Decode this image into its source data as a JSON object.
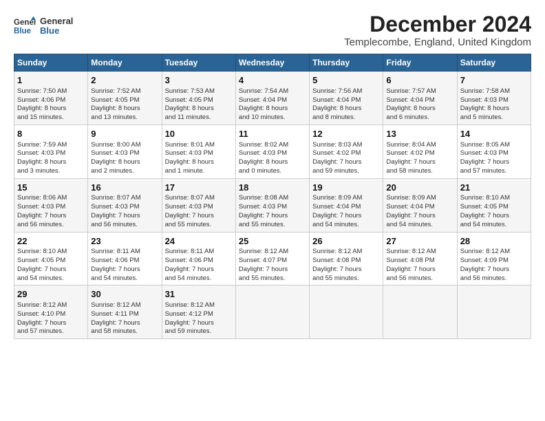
{
  "header": {
    "logo_line1": "General",
    "logo_line2": "Blue",
    "title": "December 2024",
    "subtitle": "Templecombe, England, United Kingdom"
  },
  "days_of_week": [
    "Sunday",
    "Monday",
    "Tuesday",
    "Wednesday",
    "Thursday",
    "Friday",
    "Saturday"
  ],
  "weeks": [
    [
      {
        "day": "1",
        "info": "Sunrise: 7:50 AM\nSunset: 4:06 PM\nDaylight: 8 hours\nand 15 minutes."
      },
      {
        "day": "2",
        "info": "Sunrise: 7:52 AM\nSunset: 4:05 PM\nDaylight: 8 hours\nand 13 minutes."
      },
      {
        "day": "3",
        "info": "Sunrise: 7:53 AM\nSunset: 4:05 PM\nDaylight: 8 hours\nand 11 minutes."
      },
      {
        "day": "4",
        "info": "Sunrise: 7:54 AM\nSunset: 4:04 PM\nDaylight: 8 hours\nand 10 minutes."
      },
      {
        "day": "5",
        "info": "Sunrise: 7:56 AM\nSunset: 4:04 PM\nDaylight: 8 hours\nand 8 minutes."
      },
      {
        "day": "6",
        "info": "Sunrise: 7:57 AM\nSunset: 4:04 PM\nDaylight: 8 hours\nand 6 minutes."
      },
      {
        "day": "7",
        "info": "Sunrise: 7:58 AM\nSunset: 4:03 PM\nDaylight: 8 hours\nand 5 minutes."
      }
    ],
    [
      {
        "day": "8",
        "info": "Sunrise: 7:59 AM\nSunset: 4:03 PM\nDaylight: 8 hours\nand 3 minutes."
      },
      {
        "day": "9",
        "info": "Sunrise: 8:00 AM\nSunset: 4:03 PM\nDaylight: 8 hours\nand 2 minutes."
      },
      {
        "day": "10",
        "info": "Sunrise: 8:01 AM\nSunset: 4:03 PM\nDaylight: 8 hours\nand 1 minute."
      },
      {
        "day": "11",
        "info": "Sunrise: 8:02 AM\nSunset: 4:03 PM\nDaylight: 8 hours\nand 0 minutes."
      },
      {
        "day": "12",
        "info": "Sunrise: 8:03 AM\nSunset: 4:02 PM\nDaylight: 7 hours\nand 59 minutes."
      },
      {
        "day": "13",
        "info": "Sunrise: 8:04 AM\nSunset: 4:02 PM\nDaylight: 7 hours\nand 58 minutes."
      },
      {
        "day": "14",
        "info": "Sunrise: 8:05 AM\nSunset: 4:03 PM\nDaylight: 7 hours\nand 57 minutes."
      }
    ],
    [
      {
        "day": "15",
        "info": "Sunrise: 8:06 AM\nSunset: 4:03 PM\nDaylight: 7 hours\nand 56 minutes."
      },
      {
        "day": "16",
        "info": "Sunrise: 8:07 AM\nSunset: 4:03 PM\nDaylight: 7 hours\nand 56 minutes."
      },
      {
        "day": "17",
        "info": "Sunrise: 8:07 AM\nSunset: 4:03 PM\nDaylight: 7 hours\nand 55 minutes."
      },
      {
        "day": "18",
        "info": "Sunrise: 8:08 AM\nSunset: 4:03 PM\nDaylight: 7 hours\nand 55 minutes."
      },
      {
        "day": "19",
        "info": "Sunrise: 8:09 AM\nSunset: 4:04 PM\nDaylight: 7 hours\nand 54 minutes."
      },
      {
        "day": "20",
        "info": "Sunrise: 8:09 AM\nSunset: 4:04 PM\nDaylight: 7 hours\nand 54 minutes."
      },
      {
        "day": "21",
        "info": "Sunrise: 8:10 AM\nSunset: 4:05 PM\nDaylight: 7 hours\nand 54 minutes."
      }
    ],
    [
      {
        "day": "22",
        "info": "Sunrise: 8:10 AM\nSunset: 4:05 PM\nDaylight: 7 hours\nand 54 minutes."
      },
      {
        "day": "23",
        "info": "Sunrise: 8:11 AM\nSunset: 4:06 PM\nDaylight: 7 hours\nand 54 minutes."
      },
      {
        "day": "24",
        "info": "Sunrise: 8:11 AM\nSunset: 4:06 PM\nDaylight: 7 hours\nand 54 minutes."
      },
      {
        "day": "25",
        "info": "Sunrise: 8:12 AM\nSunset: 4:07 PM\nDaylight: 7 hours\nand 55 minutes."
      },
      {
        "day": "26",
        "info": "Sunrise: 8:12 AM\nSunset: 4:08 PM\nDaylight: 7 hours\nand 55 minutes."
      },
      {
        "day": "27",
        "info": "Sunrise: 8:12 AM\nSunset: 4:08 PM\nDaylight: 7 hours\nand 56 minutes."
      },
      {
        "day": "28",
        "info": "Sunrise: 8:12 AM\nSunset: 4:09 PM\nDaylight: 7 hours\nand 56 minutes."
      }
    ],
    [
      {
        "day": "29",
        "info": "Sunrise: 8:12 AM\nSunset: 4:10 PM\nDaylight: 7 hours\nand 57 minutes."
      },
      {
        "day": "30",
        "info": "Sunrise: 8:12 AM\nSunset: 4:11 PM\nDaylight: 7 hours\nand 58 minutes."
      },
      {
        "day": "31",
        "info": "Sunrise: 8:12 AM\nSunset: 4:12 PM\nDaylight: 7 hours\nand 59 minutes."
      },
      {
        "day": "",
        "info": ""
      },
      {
        "day": "",
        "info": ""
      },
      {
        "day": "",
        "info": ""
      },
      {
        "day": "",
        "info": ""
      }
    ]
  ]
}
